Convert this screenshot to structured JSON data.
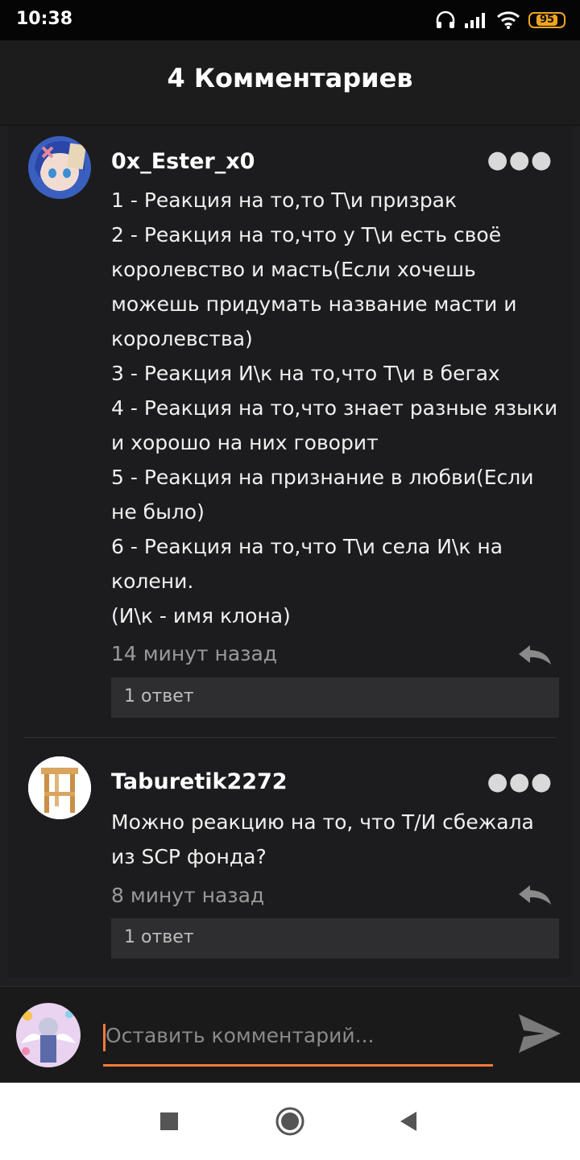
{
  "status_bar": {
    "time": "10:38",
    "battery": "95",
    "icons": [
      "headphones-icon",
      "signal-icon",
      "wifi-icon",
      "battery-icon"
    ]
  },
  "header": {
    "title": "4 Комментариев"
  },
  "comments": [
    {
      "author": "0x_Ester_x0",
      "avatar": "anime-avatar",
      "text": "1 - Реакция на то,то Т\\и призрак\n2 - Реакция на то,что у Т\\и есть своё королевство и масть(Если хочешь можешь придумать название масти и королевства)\n3 - Реакция И\\к на то,что Т\\и в бегах\n4 - Реакция на то,что знает разные языки и хорошо на них говорит\n5 - Реакция на признание в любви(Если не было)\n6 - Реакция на то,что Т\\и села И\\к на колени.\n(И\\к - имя клона)",
      "time": "14 минут назад",
      "replies": "1 ответ"
    },
    {
      "author": "Taburetik2272",
      "avatar": "stool-avatar",
      "text": "Можно реакцию на то, что Т/И сбежала из SCP фонда?",
      "time": "8 минут назад",
      "replies": "1 ответ"
    }
  ],
  "composer": {
    "placeholder": "Оставить комментарий...",
    "accent_color": "#f47c3c"
  },
  "nav_bar": {
    "buttons": [
      "recent-apps",
      "home",
      "back"
    ]
  }
}
